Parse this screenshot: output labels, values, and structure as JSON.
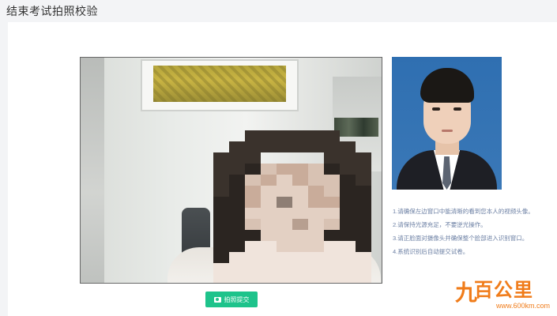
{
  "page": {
    "title": "结束考试拍照校验"
  },
  "camera": {
    "label": "camera-feed"
  },
  "id_photo": {
    "label": "reference-photo"
  },
  "instructions": [
    "1.请确保左边窗口中能清晰的看到您本人的视频头像。",
    "2.请保持光源充足，不要逆光操作。",
    "3.请正脸面对摄像头并确保整个脸部进入识别窗口。",
    "4.系统识别后自动提交试卷。"
  ],
  "actions": {
    "submit_label": "拍照提交",
    "submit_icon": "camera-icon"
  },
  "watermark": {
    "brand": "百公里",
    "mark": "九",
    "url": "www.600km.com"
  },
  "colors": {
    "accent": "#1ec38b",
    "instruction_text": "#6b7fa3",
    "watermark": "#f07c1a"
  }
}
